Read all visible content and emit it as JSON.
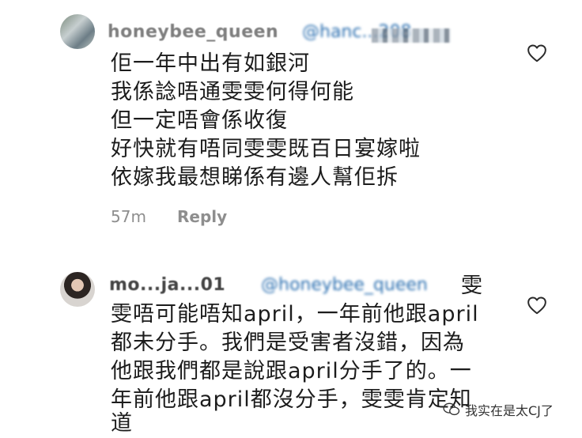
{
  "comments": [
    {
      "username": "honeybee_queen",
      "mention": "@hanc...208",
      "lines": [
        "佢一年中出有如銀河",
        "我係諗唔通雯雯何得何能",
        "但一定唔會係收復",
        "好快就有唔同雯雯既百日宴嫁啦",
        "依嫁我最想睇係有邊人幫佢拆"
      ],
      "time": "57m",
      "reply_label": "Reply"
    },
    {
      "username": "mo...ja...01",
      "mention": "@honeybee_queen",
      "lines": [
        "雯",
        "雯唔可能唔知april，一年前他跟april",
        "都未分手。我們是受害者沒錯，因為",
        "他跟我們都是說跟april分手了的。一",
        "年前他跟april都沒分手，雯雯肯定知",
        "道"
      ]
    }
  ],
  "watermark": {
    "text": "我实在是太CJ了",
    "icon": "wechat-icon"
  },
  "colors": {
    "text": "#1c1c1c",
    "meta": "#8e8e8e",
    "mention": "#2b6fb0"
  }
}
